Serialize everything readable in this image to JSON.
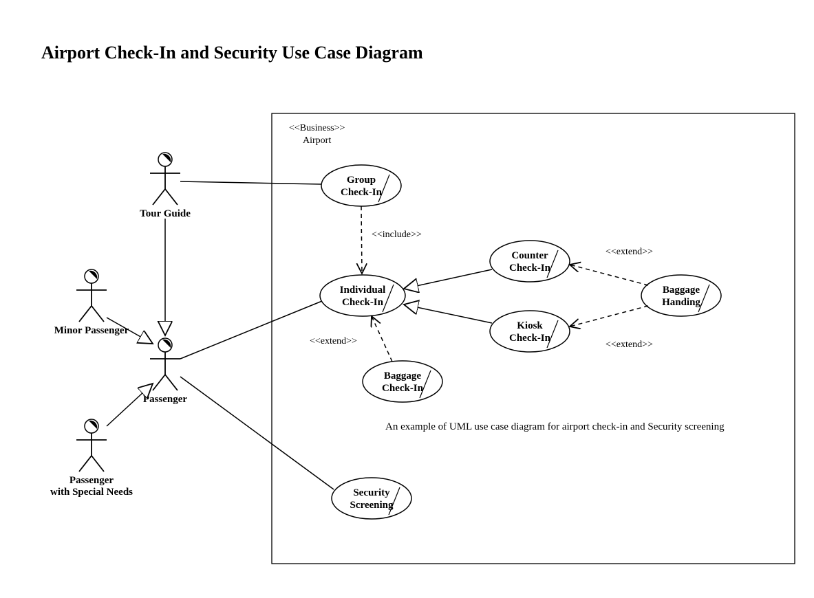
{
  "title": "Airport Check-In and Security Use Case Diagram",
  "system": {
    "stereotype": "<<Business>>",
    "name": "Airport"
  },
  "actors": {
    "tour_guide": "Tour Guide",
    "minor_passenger": "Minor Passenger",
    "passenger": "Passenger",
    "passenger_special": "Passenger",
    "passenger_special2": "with Special Needs"
  },
  "usecases": {
    "group_checkin": {
      "l1": "Group",
      "l2": "Check-In"
    },
    "individual_checkin": {
      "l1": "Individual",
      "l2": "Check-In"
    },
    "counter_checkin": {
      "l1": "Counter",
      "l2": "Check-In"
    },
    "kiosk_checkin": {
      "l1": "Kiosk",
      "l2": "Check-In"
    },
    "baggage_handing": {
      "l1": "Baggage",
      "l2": "Handing"
    },
    "baggage_checkin": {
      "l1": "Baggage",
      "l2": "Check-In"
    },
    "security_screening": {
      "l1": "Security",
      "l2": "Screening"
    }
  },
  "stereotypes": {
    "include": "<<include>>",
    "extend_top": "<<extend>>",
    "extend_left": "<<extend>>",
    "extend_bottom": "<<extend>>"
  },
  "caption": "An example of UML use case diagram for airport check-in and Security screening"
}
